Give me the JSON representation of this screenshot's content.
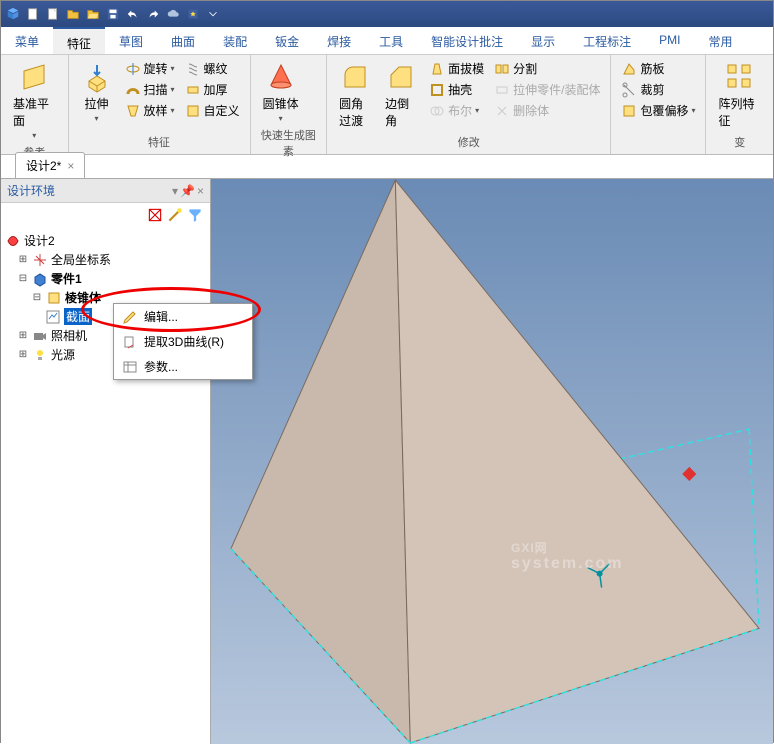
{
  "menu": {
    "tabs": [
      "菜单",
      "特征",
      "草图",
      "曲面",
      "装配",
      "钣金",
      "焊接",
      "工具",
      "智能设计批注",
      "显示",
      "工程标注",
      "PMI",
      "常用"
    ],
    "active_index": 1
  },
  "ribbon": {
    "groups": [
      {
        "label": "参考",
        "large": [
          {
            "name": "基准平面",
            "icon": "plane"
          }
        ]
      },
      {
        "label": "特征",
        "large": [
          {
            "name": "拉伸",
            "icon": "extrude"
          }
        ],
        "cols": [
          [
            {
              "name": "旋转",
              "icon": "revolve"
            },
            {
              "name": "扫描",
              "icon": "sweep"
            },
            {
              "name": "放样",
              "icon": "loft"
            }
          ],
          [
            {
              "name": "螺纹",
              "icon": "thread"
            },
            {
              "name": "加厚",
              "icon": "thicken"
            },
            {
              "name": "自定义",
              "icon": "custom"
            }
          ]
        ]
      },
      {
        "label": "快速生成图素",
        "large": [
          {
            "name": "圆锥体",
            "icon": "cone"
          }
        ]
      },
      {
        "label": "修改",
        "large": [
          {
            "name": "圆角过渡",
            "icon": "fillet"
          },
          {
            "name": "边倒角",
            "icon": "chamfer"
          }
        ],
        "cols": [
          [
            {
              "name": "面拔模",
              "icon": "draft"
            },
            {
              "name": "抽壳",
              "icon": "shell"
            },
            {
              "name": "布尔",
              "icon": "bool"
            }
          ],
          [
            {
              "name": "分割",
              "icon": "split"
            },
            {
              "name": "拉伸零件/装配体",
              "icon": "stretch"
            },
            {
              "name": "删除体",
              "icon": "delete"
            }
          ]
        ]
      },
      {
        "label": "",
        "cols": [
          [
            {
              "name": "筋板",
              "icon": "rib"
            },
            {
              "name": "裁剪",
              "icon": "trim"
            },
            {
              "name": "包覆偏移",
              "icon": "wrap"
            }
          ]
        ]
      },
      {
        "label": "变",
        "large": [
          {
            "name": "阵列特征",
            "icon": "pattern"
          }
        ]
      }
    ]
  },
  "doc_tab": {
    "title": "设计2*"
  },
  "sidebar": {
    "title": "设计环境"
  },
  "tree": {
    "root": "设计2",
    "items": [
      {
        "label": "全局坐标系",
        "icon": "axis",
        "indent": 1,
        "exp": "+"
      },
      {
        "label": "零件1",
        "icon": "part",
        "indent": 1,
        "exp": "-",
        "bold": true
      },
      {
        "label": "棱锥体",
        "icon": "solid",
        "indent": 2,
        "exp": "-",
        "bold": true
      },
      {
        "label": "截面",
        "icon": "sketch",
        "indent": 3,
        "selected": true
      },
      {
        "label": "照相机",
        "icon": "camera",
        "indent": 1,
        "exp": "+"
      },
      {
        "label": "光源",
        "icon": "light",
        "indent": 1,
        "exp": "+"
      }
    ]
  },
  "context_menu": {
    "items": [
      {
        "label": "编辑...",
        "icon": "edit"
      },
      {
        "label": "提取3D曲线(R)",
        "icon": "extract"
      },
      {
        "label": "参数...",
        "icon": "params"
      }
    ]
  },
  "watermark": {
    "main": "GXI网",
    "sub": "system.com"
  },
  "colors": {
    "accent": "#2a5aa0",
    "select": "#0a64c8",
    "annotation": "#e00"
  }
}
